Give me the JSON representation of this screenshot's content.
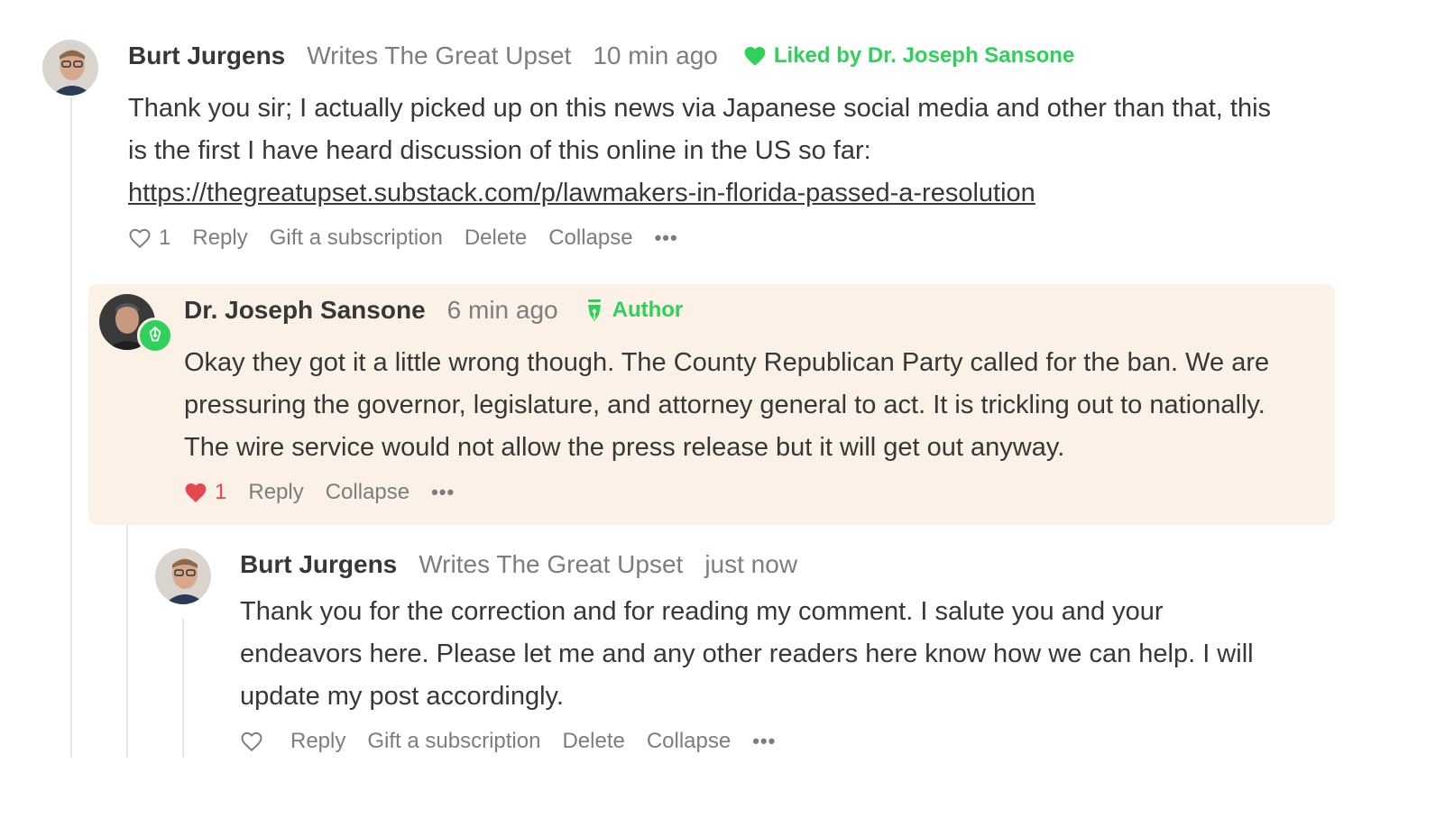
{
  "comments": [
    {
      "author": "Burt Jurgens",
      "writes": "Writes The Great Upset",
      "time": "10 min ago",
      "liked_by": "Liked by Dr. Joseph Sansone",
      "body_lines": [
        "Thank you sir; I actually picked up on this news via Japanese social media and other than that, this",
        "is the first I have heard discussion of this online in the US so far:"
      ],
      "link": "https://thegreatupset.substack.com/p/lawmakers-in-florida-passed-a-resolution",
      "like_count": "1",
      "actions": {
        "reply": "Reply",
        "gift": "Gift a subscription",
        "delete": "Delete",
        "collapse": "Collapse",
        "more": "•••"
      }
    },
    {
      "author": "Dr. Joseph Sansone",
      "time": "6 min ago",
      "tag": "Author",
      "body_lines": [
        "Okay they got it a little wrong though. The County Republican Party called for the ban. We are",
        "pressuring the governor, legislature, and attorney general to act. It is trickling out to nationally.",
        "The wire service would not allow the press release but it will get out anyway."
      ],
      "like_count": "1",
      "actions": {
        "reply": "Reply",
        "collapse": "Collapse",
        "more": "•••"
      }
    },
    {
      "author": "Burt Jurgens",
      "writes": "Writes The Great Upset",
      "time": "just now",
      "body_lines": [
        "Thank you for the correction and for reading my comment. I salute you and your",
        "endeavors here. Please let me and any other readers here know how we can help. I will",
        "update my post accordingly."
      ],
      "actions": {
        "reply": "Reply",
        "gift": "Gift a subscription",
        "delete": "Delete",
        "collapse": "Collapse",
        "more": "•••"
      }
    }
  ],
  "colors": {
    "accent_green": "#2fd15a",
    "like_red": "#e5484d",
    "highlight_bg": "#fbf1e7",
    "muted": "#7d7d7d",
    "text": "#363737"
  },
  "icons": {
    "heart_outline": "heart-outline-icon",
    "heart_filled": "heart-filled-icon",
    "author_pen": "pen-nib-icon",
    "more": "more-horizontal-icon"
  }
}
